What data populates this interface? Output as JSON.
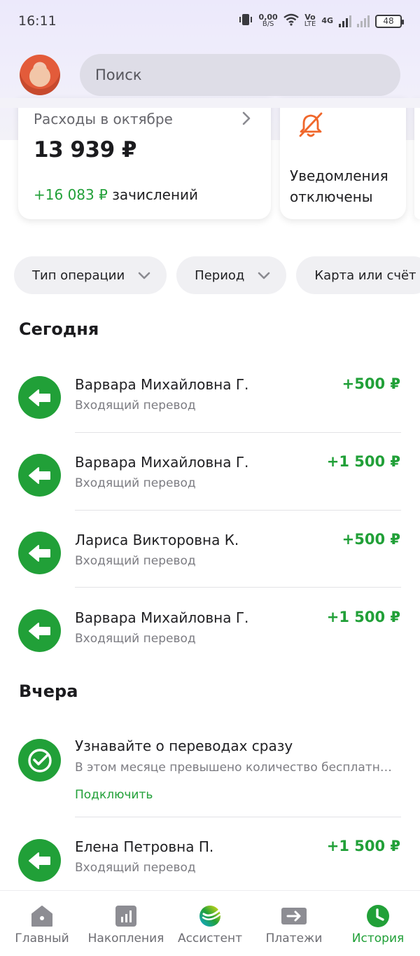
{
  "status_bar": {
    "time": "16:11",
    "net_speed": "0,00",
    "net_unit": "B/S",
    "volte_top": "Vo",
    "volte_bottom": "LTE",
    "network": "4G",
    "battery": "48"
  },
  "search": {
    "placeholder": "Поиск"
  },
  "summary": {
    "title": "Расходы в октябре",
    "amount": "13 939 ₽",
    "income_amount": "+16 083 ₽",
    "income_label": "зачислений",
    "notif_line1": "Уведомления",
    "notif_line2": "отключены"
  },
  "filters": [
    {
      "label": "Тип операции"
    },
    {
      "label": "Период"
    },
    {
      "label": "Карта или счёт"
    }
  ],
  "sections": {
    "today": "Сегодня",
    "yesterday": "Вчера"
  },
  "transactions_today": [
    {
      "name": "Варвара Михайловна Г.",
      "type": "Входящий перевод",
      "amount": "+500 ₽"
    },
    {
      "name": "Варвара Михайловна Г.",
      "type": "Входящий перевод",
      "amount": "+1 500 ₽"
    },
    {
      "name": "Лариса Викторовна К.",
      "type": "Входящий перевод",
      "amount": "+500 ₽"
    },
    {
      "name": "Варвара Михайловна Г.",
      "type": "Входящий перевод",
      "amount": "+1 500 ₽"
    }
  ],
  "promo": {
    "title": "Узнавайте о переводах сразу",
    "text": "В этом месяце превышено количество бесплатн…",
    "link": "Подключить"
  },
  "transactions_yesterday": [
    {
      "name": "Елена Петровна П.",
      "type": "Входящий перевод",
      "amount": "+1 500 ₽"
    }
  ],
  "nav": [
    {
      "label": "Главный",
      "icon": "home-icon"
    },
    {
      "label": "Накопления",
      "icon": "savings-chart-icon"
    },
    {
      "label": "Ассистент",
      "icon": "assistant-logo-icon"
    },
    {
      "label": "Платежи",
      "icon": "payments-arrow-icon"
    },
    {
      "label": "История",
      "icon": "history-clock-icon",
      "active": true
    }
  ],
  "colors": {
    "accent_green": "#21a038",
    "notification_orange": "#f0672b",
    "inactive_gray": "#6d6d73"
  }
}
